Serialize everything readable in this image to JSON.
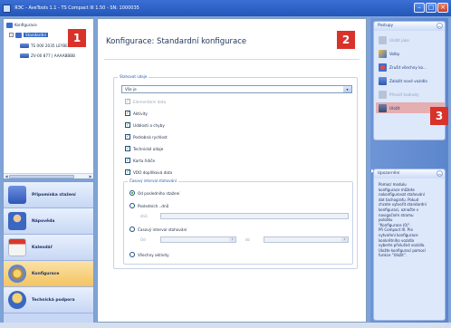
{
  "window": {
    "title": "ЯЭС - AveTools 1.1 - TS Compact III 1.50 - SN: 1000035"
  },
  "tree": {
    "root": {
      "label": "Konfigurace"
    },
    "selected": {
      "label": "Standardní"
    },
    "devices": [
      {
        "label": "TS 000 2035 LEYBERSCHB"
      },
      {
        "label": "ZV-00 877 | AAAABBBB"
      }
    ]
  },
  "nav": {
    "items": [
      {
        "label": "Připomínka stažení",
        "icon": "reminder-icon"
      },
      {
        "label": "Nápověda",
        "icon": "help-person-icon"
      },
      {
        "label": "Kalendář",
        "icon": "calendar-icon"
      },
      {
        "label": "Konfigurace",
        "icon": "gear-icon",
        "active": true
      },
      {
        "label": "Technická podpora",
        "icon": "support-icon"
      }
    ]
  },
  "main": {
    "title": "Konfigurace: Standardní konfigurace",
    "group_legend": "Stahovat údaje",
    "combo_value": "Vše je",
    "checks": [
      {
        "label": "Elementární data",
        "checked": true,
        "disabled": true
      },
      {
        "label": "Aktivity",
        "checked": true
      },
      {
        "label": "Události a chyby",
        "checked": true
      },
      {
        "label": "Podrobná rychlost",
        "checked": true
      },
      {
        "label": "Technické údaje",
        "checked": true
      },
      {
        "label": "Karta řidiče",
        "checked": true
      },
      {
        "label": "VDO doplňková data",
        "checked": true
      }
    ],
    "time_legend": "Časový interval stahování",
    "radios": [
      {
        "label": "Od posledního stažení",
        "selected": true
      },
      {
        "label": "Posledních ..dnů"
      },
      {
        "label": "Časový interval stahování"
      },
      {
        "label": "Všechny aktivity"
      }
    ],
    "days_label": "dnů",
    "from_label": "Od",
    "to_label": "do"
  },
  "actions": {
    "header": "Postupy",
    "items": [
      {
        "label": "Uložit jako",
        "icon": "save-as-icon",
        "disabled": true
      },
      {
        "label": "Volby",
        "icon": "options-icon"
      },
      {
        "label": "Zrušit všechny ko...",
        "icon": "cancel-all-icon"
      },
      {
        "label": "Založit nové vozidlo",
        "icon": "new-vehicle-icon"
      },
      {
        "label": "Převzít hodnoty",
        "icon": "take-values-icon",
        "disabled": true
      },
      {
        "label": "Uložit",
        "icon": "save-icon",
        "highlighted": true
      }
    ]
  },
  "help": {
    "header": "Upozornění",
    "text": "Pomocí modulu\nkonfigurace můžete\nnakonfigurovat stahování\ndat tachografu. Pokud\nchcete vytvořit standardní\nkonfiguraci, označte v\nnavigačním stromu\npoložku\n\"Konfigurace (0)\".\nPři Compact III. Pro\nvytvoření konfigurace\nkonkrétního vozidla\nvyberte příslušné vozidlo.\nUložte konfiguraci pomocí\nfunkce \"Uložit\"."
  },
  "badges": [
    "1",
    "2",
    "3"
  ],
  "colors": {
    "accent": "#316ac5",
    "badge": "#d9322a",
    "check": "#21a121"
  }
}
